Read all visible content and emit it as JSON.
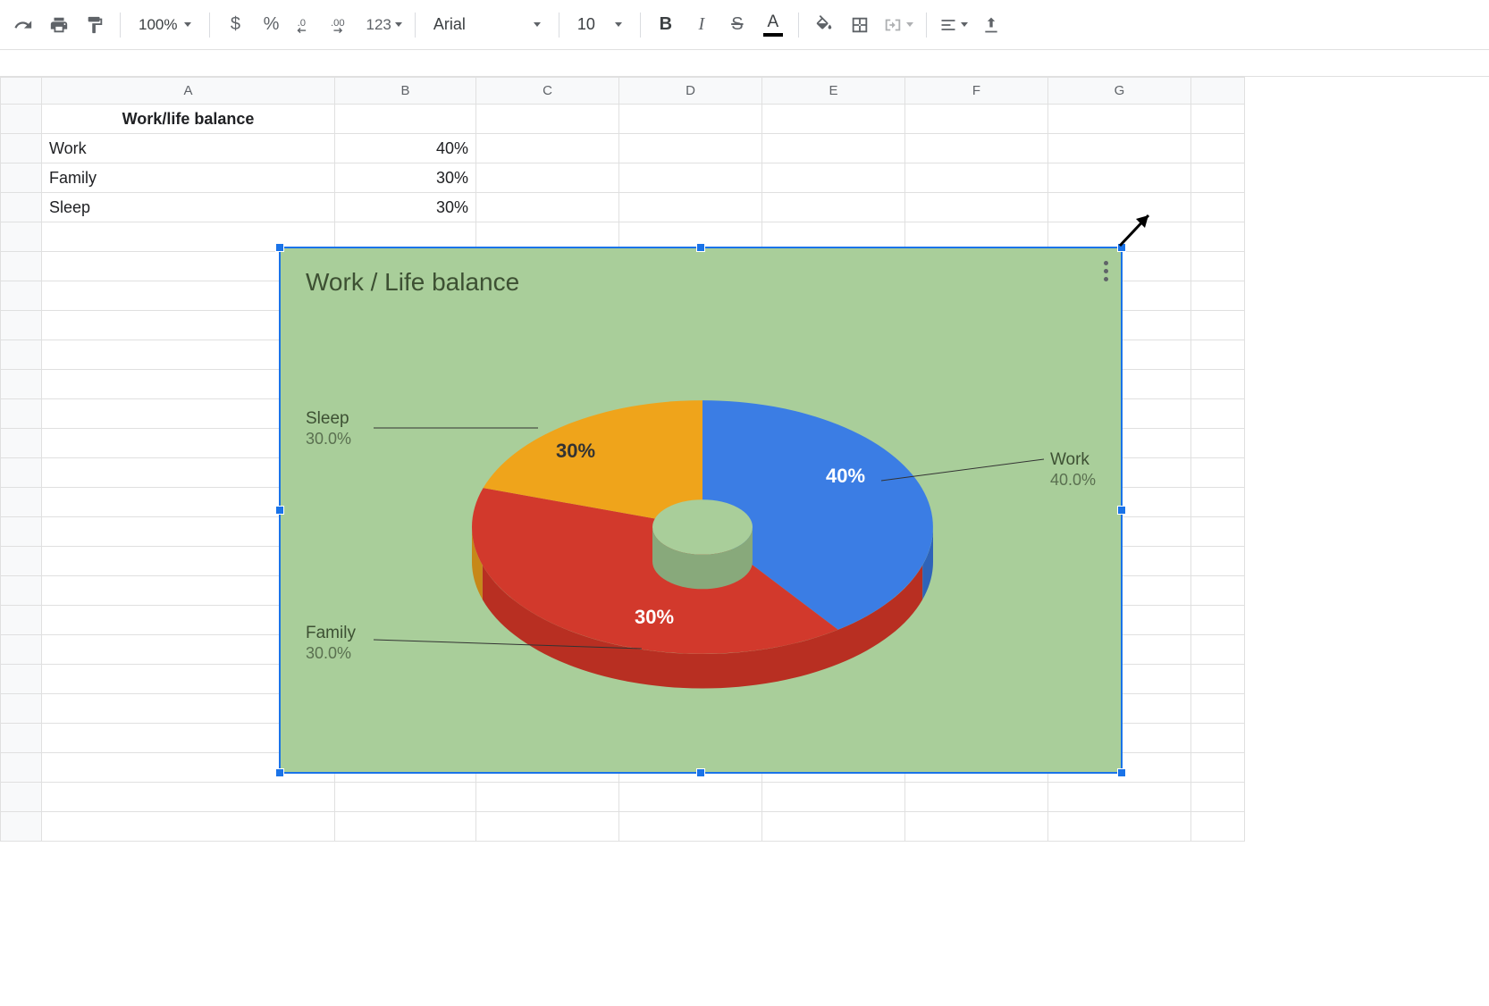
{
  "toolbar": {
    "zoom": "100%",
    "font_name": "Arial",
    "font_size": "10",
    "number_format_label": "123"
  },
  "spreadsheet": {
    "columns": [
      "A",
      "B",
      "C",
      "D",
      "E",
      "F",
      "G"
    ],
    "header_cell": "Work/life balance",
    "rows": [
      {
        "label": "Work",
        "value": "40%"
      },
      {
        "label": "Family",
        "value": "30%"
      },
      {
        "label": "Sleep",
        "value": "30%"
      }
    ]
  },
  "chart": {
    "title": "Work / Life balance",
    "slice_labels": {
      "work": "40%",
      "family": "30%",
      "sleep": "30%"
    },
    "ext_labels": {
      "work": {
        "name": "Work",
        "pct": "40.0%"
      },
      "family": {
        "name": "Family",
        "pct": "30.0%"
      },
      "sleep": {
        "name": "Sleep",
        "pct": "30.0%"
      }
    }
  },
  "chart_data": {
    "type": "pie",
    "title": "Work / Life balance",
    "categories": [
      "Work",
      "Family",
      "Sleep"
    ],
    "values": [
      40,
      30,
      30
    ],
    "colors": [
      "#3b7de4",
      "#d2392c",
      "#efa41b"
    ],
    "donut_hole_ratio": 0.22,
    "background": "#a9ce9a"
  }
}
